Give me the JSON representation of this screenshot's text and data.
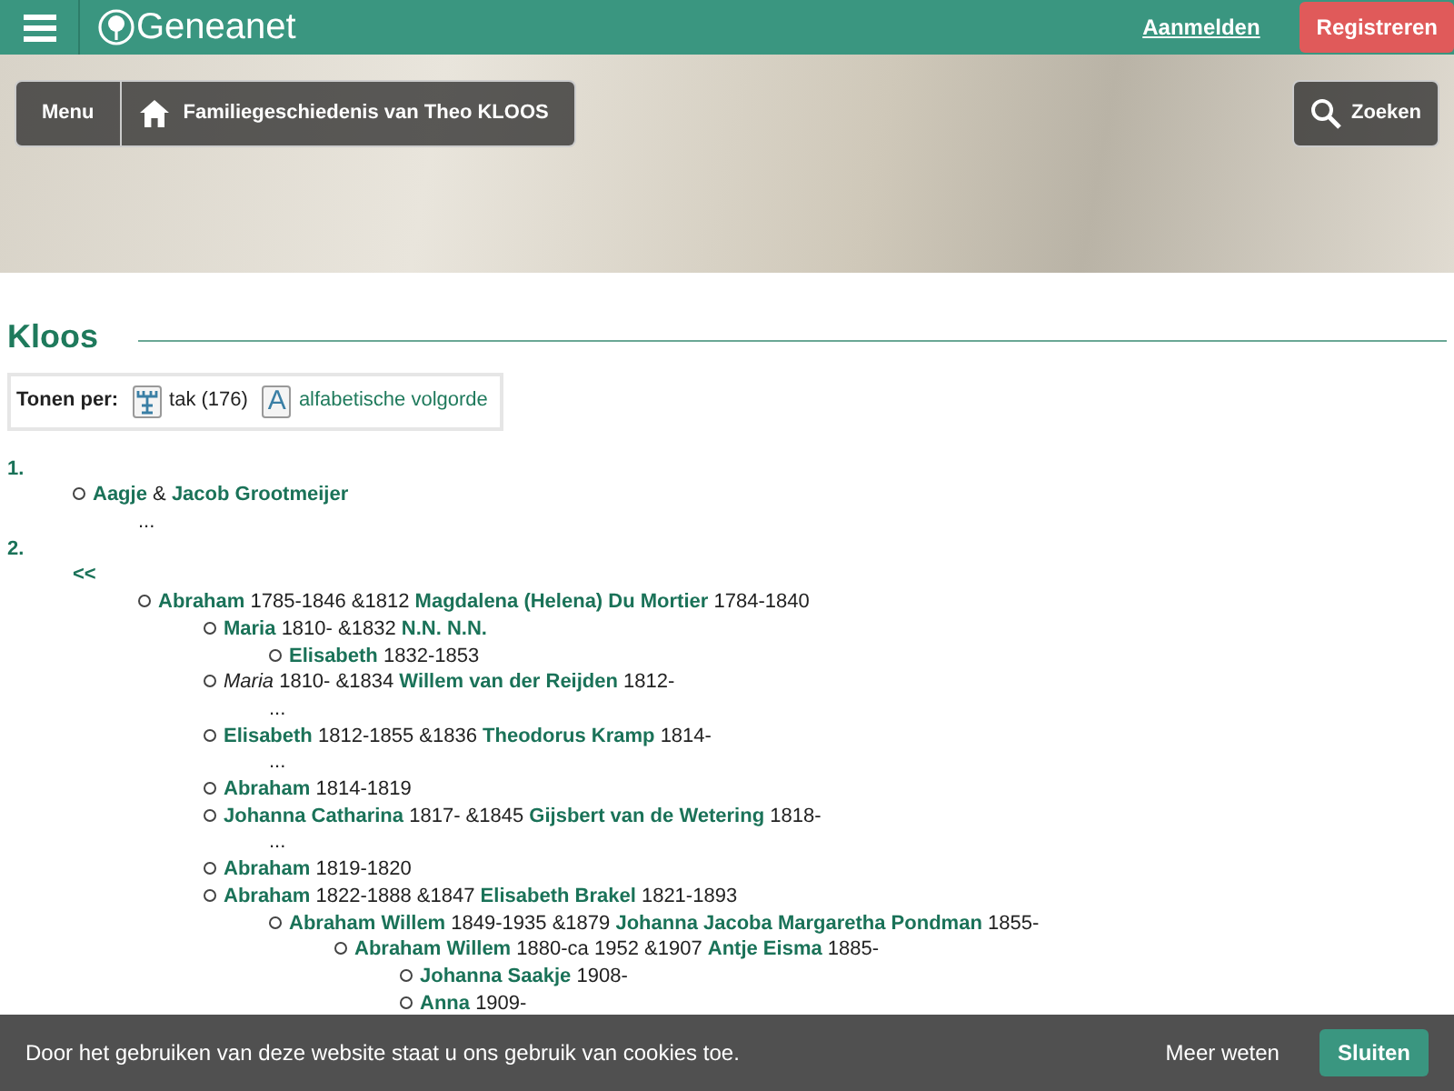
{
  "topbar": {
    "logo": "Geneanet",
    "login": "Aanmelden",
    "register": "Registreren"
  },
  "banner": {
    "menu": "Menu",
    "breadcrumb": "Familiegeschiedenis van Theo KLOOS",
    "search": "Zoeken"
  },
  "title": "Kloos",
  "view_options": {
    "label": "Tonen per:",
    "options": [
      {
        "kind": "branch",
        "text": "tak (176)",
        "selected": true
      },
      {
        "kind": "alphabet",
        "icon_letter": "A",
        "text": "alfabetische volgorde",
        "selected": false
      }
    ]
  },
  "tree": [
    {
      "number": "1.",
      "children": [
        {
          "kind": "couple",
          "name": "Aagje",
          "marriage": "&",
          "spouse": "Jacob Grootmeijer",
          "children": [
            {
              "kind": "ellipsis",
              "text": "..."
            }
          ]
        }
      ]
    },
    {
      "number": "2.",
      "children": [
        {
          "kind": "back",
          "text": "<<",
          "children": [
            {
              "kind": "couple",
              "name": "Abraham",
              "dates": "1785-1846",
              "marriage": "&1812",
              "spouse": "Magdalena (Helena) Du Mortier",
              "spouse_dates": "1784-1840",
              "children": [
                {
                  "kind": "couple",
                  "name": "Maria",
                  "dates": "1810-",
                  "marriage": "&1832",
                  "spouse": "N.N. N.N.",
                  "children": [
                    {
                      "kind": "person",
                      "name": "Elisabeth",
                      "dates": "1832-1853"
                    }
                  ]
                },
                {
                  "kind": "couple",
                  "name": "Maria",
                  "name_italic": true,
                  "dates": "1810-",
                  "marriage": "&1834",
                  "spouse": "Willem van der Reijden",
                  "spouse_dates": "1812-",
                  "children": [
                    {
                      "kind": "ellipsis",
                      "text": "..."
                    }
                  ]
                },
                {
                  "kind": "couple",
                  "name": "Elisabeth",
                  "dates": "1812-1855",
                  "marriage": "&1836",
                  "spouse": "Theodorus Kramp",
                  "spouse_dates": "1814-",
                  "children": [
                    {
                      "kind": "ellipsis",
                      "text": "..."
                    }
                  ]
                },
                {
                  "kind": "person",
                  "name": "Abraham",
                  "dates": "1814-1819"
                },
                {
                  "kind": "couple",
                  "name": "Johanna Catharina",
                  "dates": "1817-",
                  "marriage": "&1845",
                  "spouse": "Gijsbert van de Wetering",
                  "spouse_dates": "1818-",
                  "children": [
                    {
                      "kind": "ellipsis",
                      "text": "..."
                    }
                  ]
                },
                {
                  "kind": "person",
                  "name": "Abraham",
                  "dates": "1819-1820"
                },
                {
                  "kind": "couple",
                  "name": "Abraham",
                  "dates": "1822-1888",
                  "marriage": "&1847",
                  "spouse": "Elisabeth Brakel",
                  "spouse_dates": "1821-1893",
                  "children": [
                    {
                      "kind": "couple",
                      "name": "Abraham Willem",
                      "dates": "1849-1935",
                      "marriage": "&1879",
                      "spouse": "Johanna Jacoba Margaretha Pondman",
                      "spouse_dates": "1855-",
                      "children": [
                        {
                          "kind": "couple",
                          "name": "Abraham Willem",
                          "dates": "1880-ca 1952",
                          "marriage": "&1907",
                          "spouse": "Antje Eisma",
                          "spouse_dates": "1885-",
                          "children": [
                            {
                              "kind": "person",
                              "name": "Johanna Saakje",
                              "dates": "1908-"
                            },
                            {
                              "kind": "person",
                              "name": "Anna",
                              "dates": "1909-"
                            }
                          ]
                        }
                      ]
                    }
                  ]
                }
              ]
            }
          ]
        }
      ]
    }
  ],
  "cookie_bar": {
    "text": "Door het gebruiken van deze website staat u ons gebruik van cookies toe.",
    "more": "Meer weten",
    "close": "Sluiten"
  }
}
